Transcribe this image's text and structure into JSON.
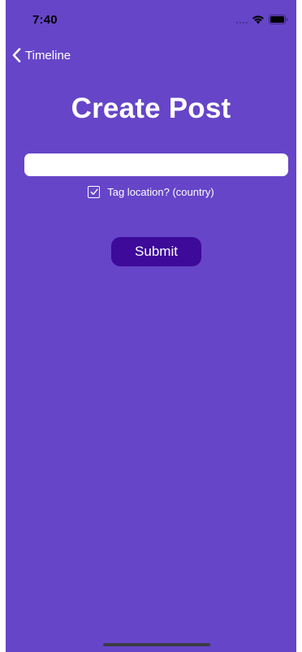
{
  "status_bar": {
    "time": "7:40",
    "icons": [
      "signal-dots-icon",
      "wifi-icon",
      "battery-icon"
    ]
  },
  "nav": {
    "back_label": "Timeline",
    "back_icon": "chevron-left-icon"
  },
  "page": {
    "title": "Create Post",
    "input_value": "",
    "input_placeholder": "",
    "tag_location_label": "Tag location? (country)",
    "tag_location_checked": true,
    "submit_label": "Submit"
  },
  "colors": {
    "background": "#6645c8",
    "button": "#3d0a9a",
    "text": "#ffffff"
  }
}
